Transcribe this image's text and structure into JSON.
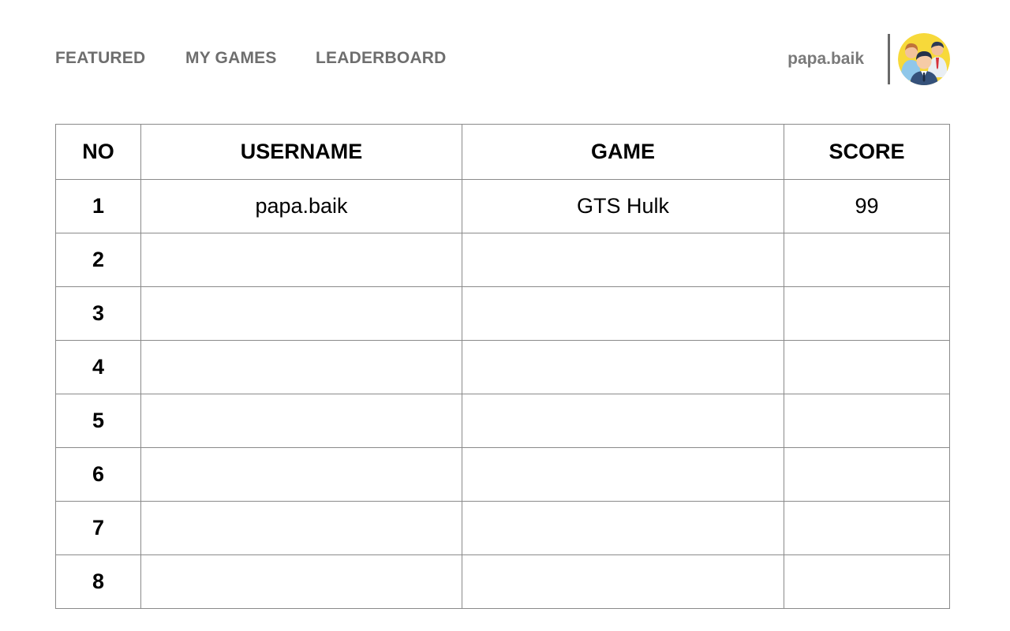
{
  "nav": {
    "featured": "FEATURED",
    "my_games": "MY GAMES",
    "leaderboard": "LEADERBOARD"
  },
  "user": {
    "name": "papa.baik",
    "avatar_icon": "people-group-avatar-icon"
  },
  "table": {
    "headers": {
      "no": "NO",
      "username": "USERNAME",
      "game": "GAME",
      "score": "SCORE"
    },
    "rows": [
      {
        "no": "1",
        "username": "papa.baik",
        "game": "GTS Hulk",
        "score": "99"
      },
      {
        "no": "2",
        "username": "",
        "game": "",
        "score": ""
      },
      {
        "no": "3",
        "username": "",
        "game": "",
        "score": ""
      },
      {
        "no": "4",
        "username": "",
        "game": "",
        "score": ""
      },
      {
        "no": "5",
        "username": "",
        "game": "",
        "score": ""
      },
      {
        "no": "6",
        "username": "",
        "game": "",
        "score": ""
      },
      {
        "no": "7",
        "username": "",
        "game": "",
        "score": ""
      },
      {
        "no": "8",
        "username": "",
        "game": "",
        "score": ""
      }
    ]
  },
  "colors": {
    "nav_text": "#6e6e6e",
    "grid_border": "#8a8a8a",
    "avatar_bg": "#f7d93a"
  }
}
